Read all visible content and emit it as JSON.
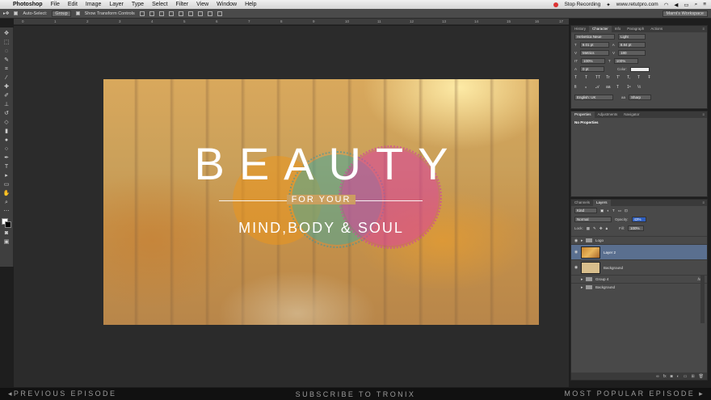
{
  "menubar": {
    "apple": "",
    "app": "Photoshop",
    "items": [
      "File",
      "Edit",
      "Image",
      "Layer",
      "Type",
      "Select",
      "Filter",
      "View",
      "Window",
      "Help"
    ],
    "recording": "Stop Recording",
    "url": "www.retutpro.com"
  },
  "options": {
    "auto_select_label": "Auto-Select:",
    "auto_select_value": "Group",
    "show_transform": "Show Transform Controls",
    "workspace": "Marni's Workspace"
  },
  "ruler": {
    "ticks": [
      "0",
      "1",
      "2",
      "3",
      "4",
      "5",
      "6",
      "7",
      "8",
      "9",
      "10",
      "11",
      "12",
      "13",
      "14",
      "15",
      "16",
      "17"
    ]
  },
  "canvas": {
    "title": "BEAUTY",
    "subtitle": "FOR YOUR",
    "tagline": "MIND,BODY & SOUL"
  },
  "character_panel": {
    "tabs": [
      "History",
      "Character",
      "Info",
      "Paragraph",
      "Actions"
    ],
    "active_tab": "Character",
    "font": "Helvetica Neue",
    "style": "Light",
    "size": "9.01 pt",
    "leading": "8.84 pt",
    "kerning": "Metrics",
    "tracking": "180",
    "vscale": "100%",
    "hscale": "100%",
    "baseline": "0 pt",
    "color_label": "Color:",
    "type_buttons": [
      "T",
      "T",
      "TT",
      "Tr",
      "T'",
      "T,",
      "T",
      "Ŧ"
    ],
    "language": "English: UK",
    "aa_label": "aa",
    "antialias": "Sharp"
  },
  "properties_panel": {
    "tabs": [
      "Properties",
      "Adjustments",
      "Navigator"
    ],
    "content": "No Properties"
  },
  "layers_panel": {
    "tabs": [
      "Channels",
      "Layers"
    ],
    "filter": "Kind",
    "blend_mode": "Normal",
    "opacity_label": "Opacity:",
    "opacity": "43%",
    "lock_label": "Lock:",
    "fill_label": "Fill:",
    "fill": "100%",
    "layers": [
      {
        "name": "Logo",
        "type": "group",
        "visible": true
      },
      {
        "name": "Layer 2",
        "type": "image",
        "visible": true,
        "selected": true
      },
      {
        "name": "Background",
        "type": "fill",
        "visible": true
      },
      {
        "name": "Group 4",
        "type": "group",
        "visible": false,
        "fx": "fx"
      },
      {
        "name": "Background",
        "type": "group",
        "visible": false
      }
    ]
  },
  "bottombar": {
    "previous": "◂PREVIOUS EPISODE",
    "subscribe": "SUBSCRIBE TO TRONIX",
    "popular": "MOST POPULAR EPISODE ▸"
  }
}
